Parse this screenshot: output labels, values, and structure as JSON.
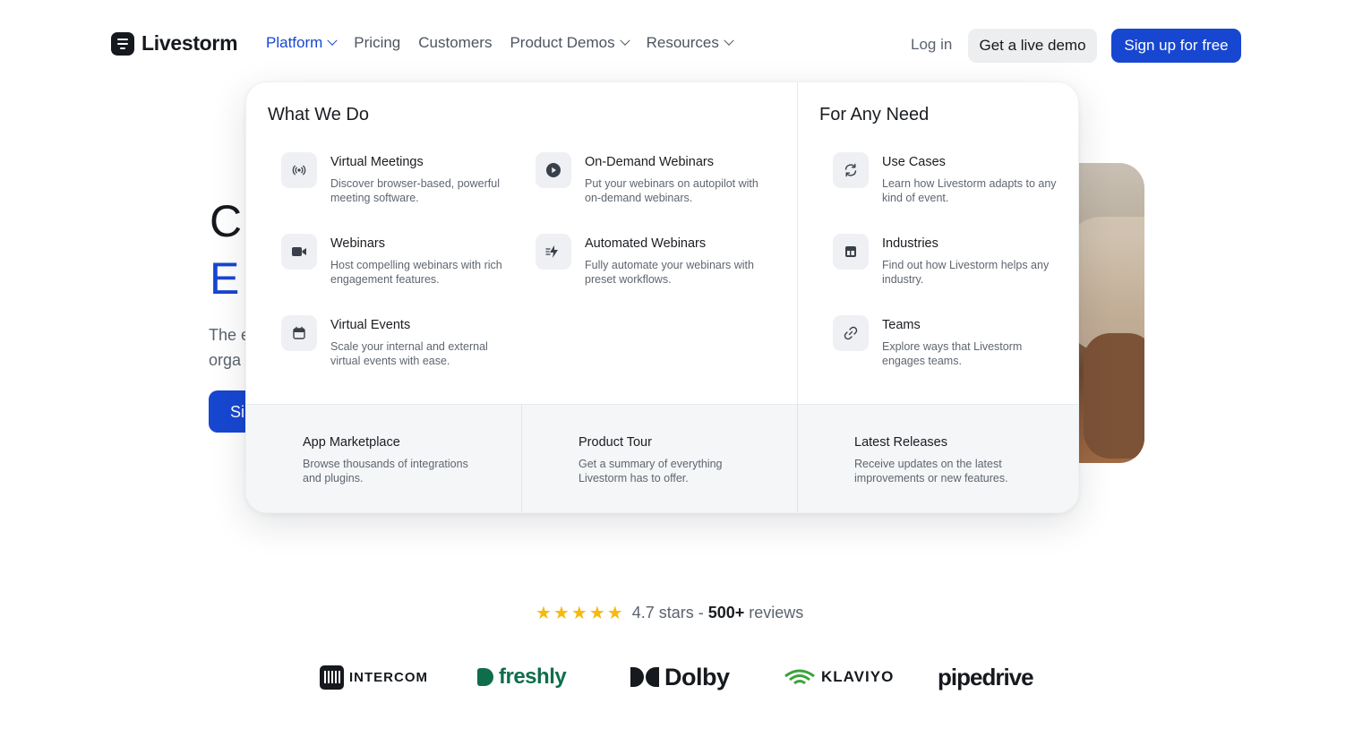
{
  "brand": {
    "name": "Livestorm"
  },
  "nav": {
    "items": [
      {
        "label": "Platform",
        "dropdown": true,
        "active": true
      },
      {
        "label": "Pricing",
        "dropdown": false
      },
      {
        "label": "Customers",
        "dropdown": false
      },
      {
        "label": "Product Demos",
        "dropdown": true
      },
      {
        "label": "Resources",
        "dropdown": true
      }
    ],
    "login": "Log in",
    "demo_button": "Get a live demo",
    "signup_button": "Sign up for free"
  },
  "hero": {
    "line1": "C",
    "line2": "E",
    "paragraph_line1": "The e",
    "paragraph_line2": "orga",
    "cta": "Si"
  },
  "dropdown": {
    "what_we_do_title": "What We Do",
    "for_any_need_title": "For Any Need",
    "what_we_do": [
      {
        "title": "Virtual Meetings",
        "desc": "Discover browser-based, powerful meeting software.",
        "icon": "broadcast-icon"
      },
      {
        "title": "On-Demand Webinars",
        "desc": "Put your webinars on autopilot with on-demand webinars.",
        "icon": "play-icon"
      },
      {
        "title": "Webinars",
        "desc": "Host compelling webinars with rich engagement features.",
        "icon": "video-camera-icon"
      },
      {
        "title": "Automated Webinars",
        "desc": "Fully automate your webinars with preset workflows.",
        "icon": "lightning-icon"
      },
      {
        "title": "Virtual Events",
        "desc": "Scale your internal and external virtual events with ease.",
        "icon": "calendar-icon"
      }
    ],
    "for_any_need": [
      {
        "title": "Use Cases",
        "desc": "Learn how Livestorm adapts to any kind of event.",
        "icon": "refresh-icon"
      },
      {
        "title": "Industries",
        "desc": "Find out how Livestorm helps any industry.",
        "icon": "layout-icon"
      },
      {
        "title": "Teams",
        "desc": "Explore ways that Livestorm engages teams.",
        "icon": "link-icon"
      }
    ],
    "footer": [
      {
        "title": "App Marketplace",
        "desc": "Browse thousands of integrations and plugins."
      },
      {
        "title": "Product Tour",
        "desc": "Get a summary of everything Livestorm has to offer."
      },
      {
        "title": "Latest Releases",
        "desc": "Receive updates on the latest improvements or new features."
      }
    ]
  },
  "reviews": {
    "stars": 5,
    "rating_text": "4.7 stars - ",
    "count_text": "500+",
    "suffix": " reviews"
  },
  "customer_logos": [
    {
      "name": "INTERCOM"
    },
    {
      "name": "freshly"
    },
    {
      "name": "Dolby"
    },
    {
      "name": "KLAVIYO"
    },
    {
      "name": "pipedrive"
    }
  ],
  "colors": {
    "accent": "#1747d1",
    "star": "#f7b90f",
    "text": "#1a1d21",
    "muted": "#5b636d"
  }
}
